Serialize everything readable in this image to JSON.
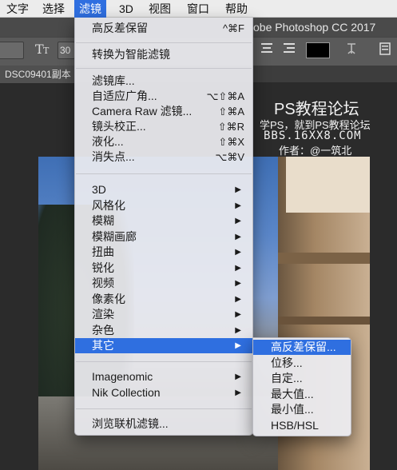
{
  "menubar": {
    "items": [
      "文字",
      "选择",
      "滤镜",
      "3D",
      "视图",
      "窗口",
      "帮助"
    ],
    "active": "滤镜"
  },
  "app": {
    "title": "obe Photoshop CC 2017"
  },
  "document": {
    "tab_label": "DSC09401副本"
  },
  "options": {
    "font_size_field": "30",
    "color_swatch": "#000000"
  },
  "watermark": {
    "title": "PS教程论坛",
    "subtitle": "学PS，就到PS教程论坛",
    "site": "BBS.16XX8.COM",
    "author": "作者：@一筑北"
  },
  "filter_menu": {
    "top_items": [
      {
        "label": "高反差保留",
        "shortcut": "^⌘F"
      },
      {
        "label": "转换为智能滤镜",
        "shortcut": ""
      }
    ],
    "gallery_items": [
      {
        "label": "滤镜库...",
        "shortcut": ""
      },
      {
        "label": "自适应广角...",
        "shortcut": "⌥⇧⌘A"
      },
      {
        "label": "Camera Raw 滤镜...",
        "shortcut": "⇧⌘A"
      },
      {
        "label": "镜头校正...",
        "shortcut": "⇧⌘R"
      },
      {
        "label": "液化...",
        "shortcut": "⇧⌘X"
      },
      {
        "label": "消失点...",
        "shortcut": "⌥⌘V"
      }
    ],
    "category_items": [
      {
        "label": "3D"
      },
      {
        "label": "风格化"
      },
      {
        "label": "模糊"
      },
      {
        "label": "模糊画廊"
      },
      {
        "label": "扭曲"
      },
      {
        "label": "锐化"
      },
      {
        "label": "视频"
      },
      {
        "label": "像素化"
      },
      {
        "label": "渲染"
      },
      {
        "label": "杂色"
      },
      {
        "label": "其它"
      }
    ],
    "highlighted": "其它",
    "plugin_items": [
      {
        "label": "Imagenomic"
      },
      {
        "label": "Nik Collection"
      }
    ],
    "browse_item": {
      "label": "浏览联机滤镜..."
    }
  },
  "submenu": {
    "items": [
      "高反差保留...",
      "位移...",
      "自定...",
      "最大值...",
      "最小值...",
      "HSB/HSL"
    ],
    "highlighted": "高反差保留..."
  }
}
